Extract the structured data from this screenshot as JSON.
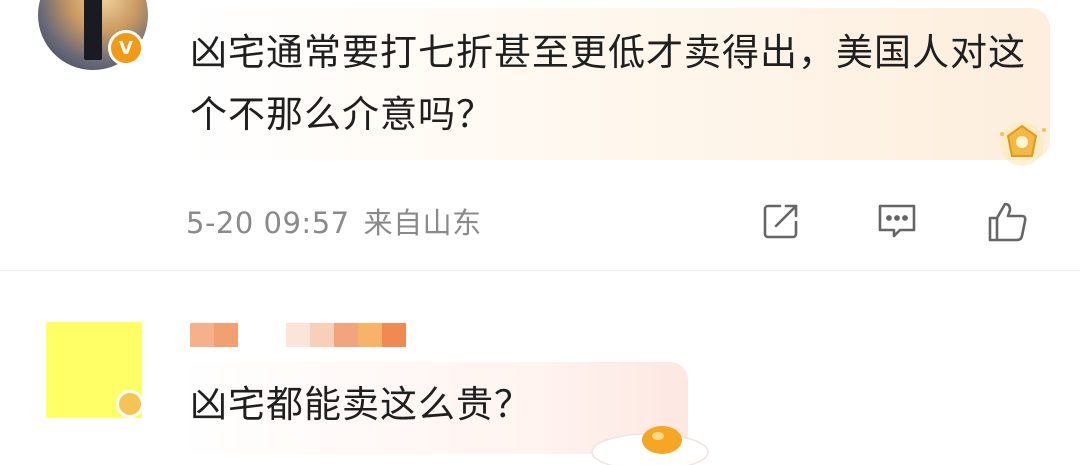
{
  "comment1": {
    "avatar_icon": "user-avatar-photo",
    "verified_badge": "V",
    "text": "凶宅通常要打七折甚至更低才卖得出，美国人对这个不那么介意吗？",
    "time": "5-20 09:57",
    "location": "来自山东",
    "actions": [
      "share-icon",
      "comment-icon",
      "like-icon"
    ],
    "decoration_icon": "crown-badge-icon"
  },
  "comment2": {
    "avatar_icon": "pixelated-avatar",
    "username_icon": "pixelated-username",
    "text": "凶宅都能卖这么贵？",
    "decoration_icon": "fried-egg-icon"
  },
  "colors": {
    "accent_orange": "#f29a16",
    "meta_gray": "#8a8a8a",
    "text_dark": "#1f1f1f"
  }
}
